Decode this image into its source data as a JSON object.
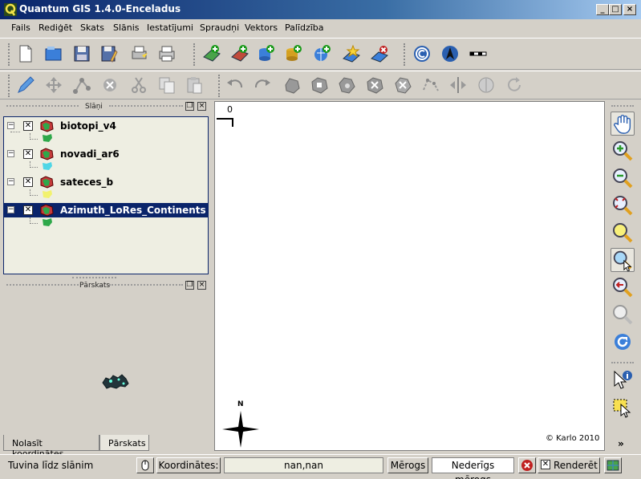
{
  "window": {
    "title": "Quantum GIS 1.4.0-Enceladus",
    "minimize": "_",
    "maximize": "□",
    "close": "×"
  },
  "menu": [
    "Fails",
    "Rediģēt",
    "Skats",
    "Slānis",
    "Iestatījumi",
    "Spraudņi",
    "Vektors",
    "Palīdzība"
  ],
  "panels": {
    "layers_title": "Slāņi",
    "overview_title": "Pārskats"
  },
  "layers": [
    {
      "name": "biotopi_v4",
      "checked": "✕",
      "expander": "−",
      "legend_color": "#2ea84a"
    },
    {
      "name": "novadi_ar6",
      "checked": "✕",
      "expander": "−",
      "legend_color": "#4fd6e6"
    },
    {
      "name": "sateces_b",
      "checked": "✕",
      "expander": "−",
      "legend_color": "#f2f26e"
    },
    {
      "name": "Azimuth_LoRes_Continents",
      "checked": "✕",
      "expander": "−",
      "legend_color": "#2ea84a",
      "selected": true
    }
  ],
  "tabs": {
    "left": "Nolasīt koordinātes",
    "right": "Pārskats"
  },
  "map": {
    "scale_label": "0",
    "north_label": "N",
    "copyright": "© Karlo 2010"
  },
  "status": {
    "hint": "Tuvina līdz slānim",
    "coords_label": "Koordinātes:",
    "coords_value": "nan,nan",
    "scale_label": "Mērogs",
    "scale_value": "Nederīgs mērogs",
    "render_label": "Renderēt",
    "render_check": "✕"
  },
  "more_tools": "»"
}
